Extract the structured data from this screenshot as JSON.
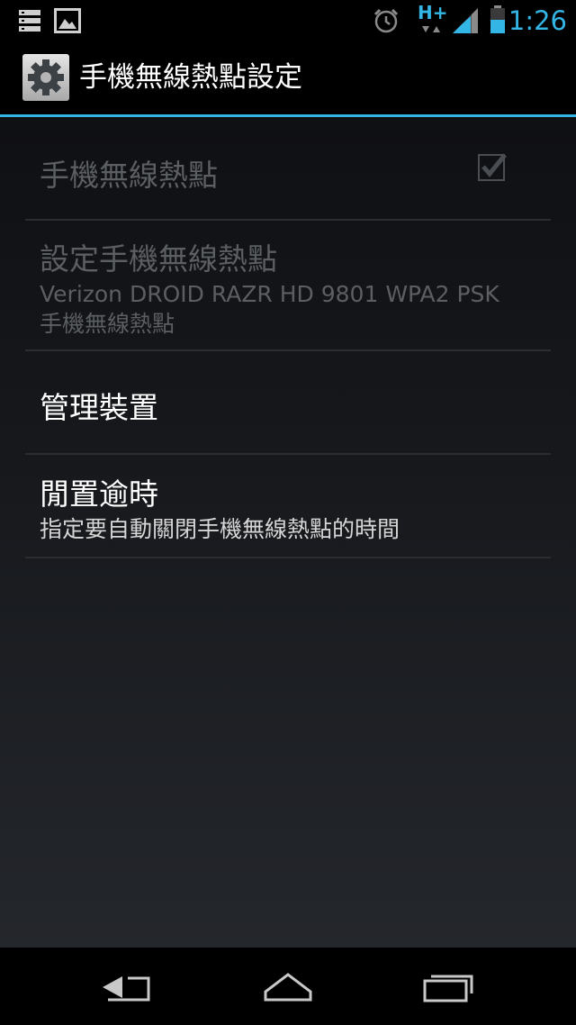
{
  "status_bar": {
    "time": "1:26",
    "network_type": "H+",
    "icons": [
      "storage-notification-icon",
      "gallery-notification-icon",
      "alarm-icon",
      "hplus-data-icon",
      "signal-icon",
      "battery-icon"
    ],
    "accent_color": "#33b5e5"
  },
  "action_bar": {
    "title": "手機無線熱點設定",
    "icon": "settings-gear-icon",
    "underline_color": "#33b5e5"
  },
  "preferences": [
    {
      "title": "手機無線熱點",
      "summary": "",
      "checked": true,
      "enabled": false
    },
    {
      "title": "設定手機無線熱點",
      "summary_line1": "Verizon DROID RAZR HD 9801 WPA2 PSK",
      "summary_line2": "手機無線熱點",
      "enabled": false
    },
    {
      "title": "管理裝置",
      "enabled": true
    },
    {
      "title": "閒置逾時",
      "summary": "指定要自動關閉手機無線熱點的時間",
      "enabled": true
    }
  ],
  "nav_bar": {
    "buttons": [
      "back-icon",
      "home-icon",
      "recents-icon"
    ]
  }
}
